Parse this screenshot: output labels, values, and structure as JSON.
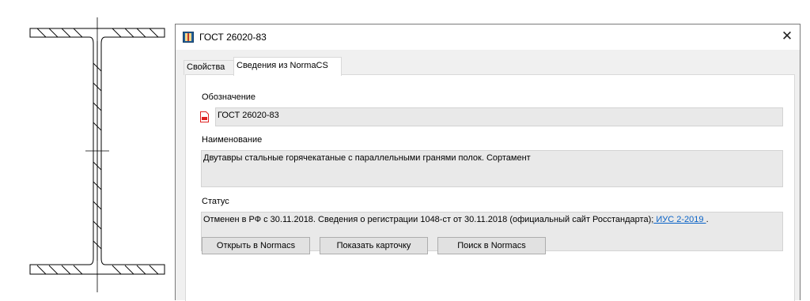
{
  "window": {
    "title": "ГОСТ 26020-83",
    "close_glyph": "✕",
    "icon": "book-icon"
  },
  "tabs": [
    {
      "label": "Свойства",
      "active": false
    },
    {
      "label": "Сведения из NormaCS",
      "active": true
    }
  ],
  "fields": {
    "designation": {
      "label": "Обозначение",
      "value": "ГОСТ 26020-83",
      "icon": "pdf-document-icon"
    },
    "name": {
      "label": "Наименование",
      "value": "Двутавры стальные горячекатаные с параллельными гранями полок. Сортамент"
    },
    "status": {
      "label": "Статус",
      "value": "Отменен в РФ с 30.11.2018. Сведения о регистрации 1048-ст от 30.11.2018 (официальный сайт Росстандарта);",
      "link": " ИУС 2-2019 ",
      "suffix": "."
    }
  },
  "buttons": {
    "open": "Открыть в Normacs",
    "card": "Показать карточку",
    "search": "Поиск в Normacs"
  },
  "colors": {
    "link": "#0a63c7",
    "field_bg": "#e9e9e9",
    "dialog_bg": "#f0f0f0"
  }
}
